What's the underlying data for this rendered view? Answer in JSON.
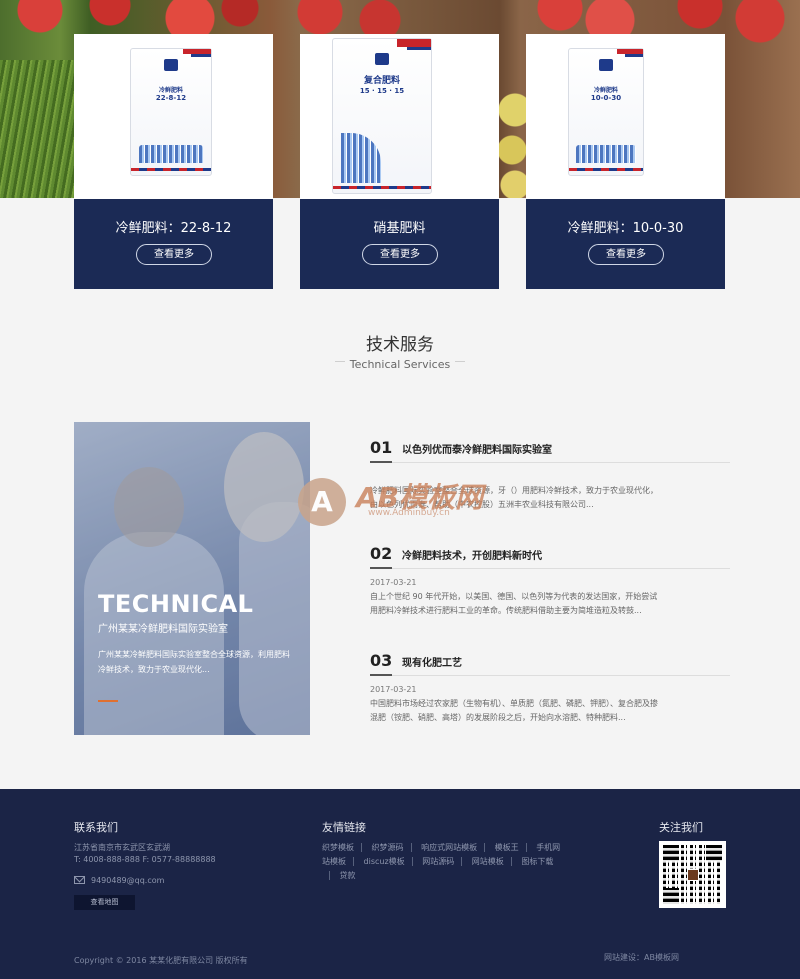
{
  "products": [
    {
      "title": "冷鲜肥料：22-8-12",
      "button": "查看更多",
      "bag_label": "22-8-12",
      "bag_name": "冷鲜肥料"
    },
    {
      "title": "硝基肥料",
      "button": "查看更多",
      "bag_label": "15 · 15 · 15",
      "bag_name": "复合肥料"
    },
    {
      "title": "冷鲜肥料：10-0-30",
      "button": "查看更多",
      "bag_label": "10-0-30",
      "bag_name": "冷鲜肥料"
    }
  ],
  "section": {
    "title": "技术服务",
    "subtitle": "Technical Services"
  },
  "tech_panel": {
    "big_text": "TECHNICAL",
    "name": "广州某某冷鲜肥料国际实验室",
    "desc": "广州某某冷鲜肥料国际实验室整合全球资源，利用肥料冷鲜技术，致力于农业现代化..."
  },
  "services": [
    {
      "num": "01",
      "title": "以色列优而泰冷鲜肥料国际实验室",
      "date": "",
      "text": "冷鲜肥料国际实验室整合全球资源，牙（）用肥料冷鲜技术，致力于农业现代化，由以色列优而泰、帮助（中农控股）五洲丰农业科技有限公司..."
    },
    {
      "num": "02",
      "title": "冷鲜肥料技术，开创肥料新时代",
      "date": "2017-03-21",
      "text": "自上个世纪 90 年代开始，以美国、德国、以色列等为代表的发达国家，开始尝试用肥料冷鲜技术进行肥料工业的革命。传统肥料借助主要为简堆造粒及转鼓..."
    },
    {
      "num": "03",
      "title": "现有化肥工艺",
      "date": "2017-03-21",
      "text": "中国肥料市场经过农家肥（生物有机）、单质肥（氮肥、磷肥、钾肥）、复合肥及掺混肥（铵肥、硝肥、高塔）的发展阶段之后，开始向水溶肥、特种肥料..."
    }
  ],
  "watermark": {
    "text": "AB模板网",
    "url": "www.Adminbuy.cn",
    "letter": "A"
  },
  "footer": {
    "contact_title": "联系我们",
    "address": "江苏省南京市玄武区玄武湖",
    "phone": "T: 4008-888-888  F: 0577-88888888",
    "email": "9490489@qq.com",
    "map_button": "查看地图",
    "links_title": "友情链接",
    "links": [
      "织梦模板",
      "织梦源码",
      "响应式网站模板",
      "模板王",
      "手机网站模板",
      "discuz模板",
      "网站源码",
      "网站模板",
      "图标下载",
      "贷款"
    ],
    "follow_title": "关注我们",
    "copyright": "Copyright © 2016 某某化肥有限公司 版权所有",
    "builder": "网站建设：AB模板网"
  },
  "colors": {
    "navy": "#1b2a55",
    "footer_bg": "#1b2446",
    "page_bg": "#f4f4f4"
  }
}
